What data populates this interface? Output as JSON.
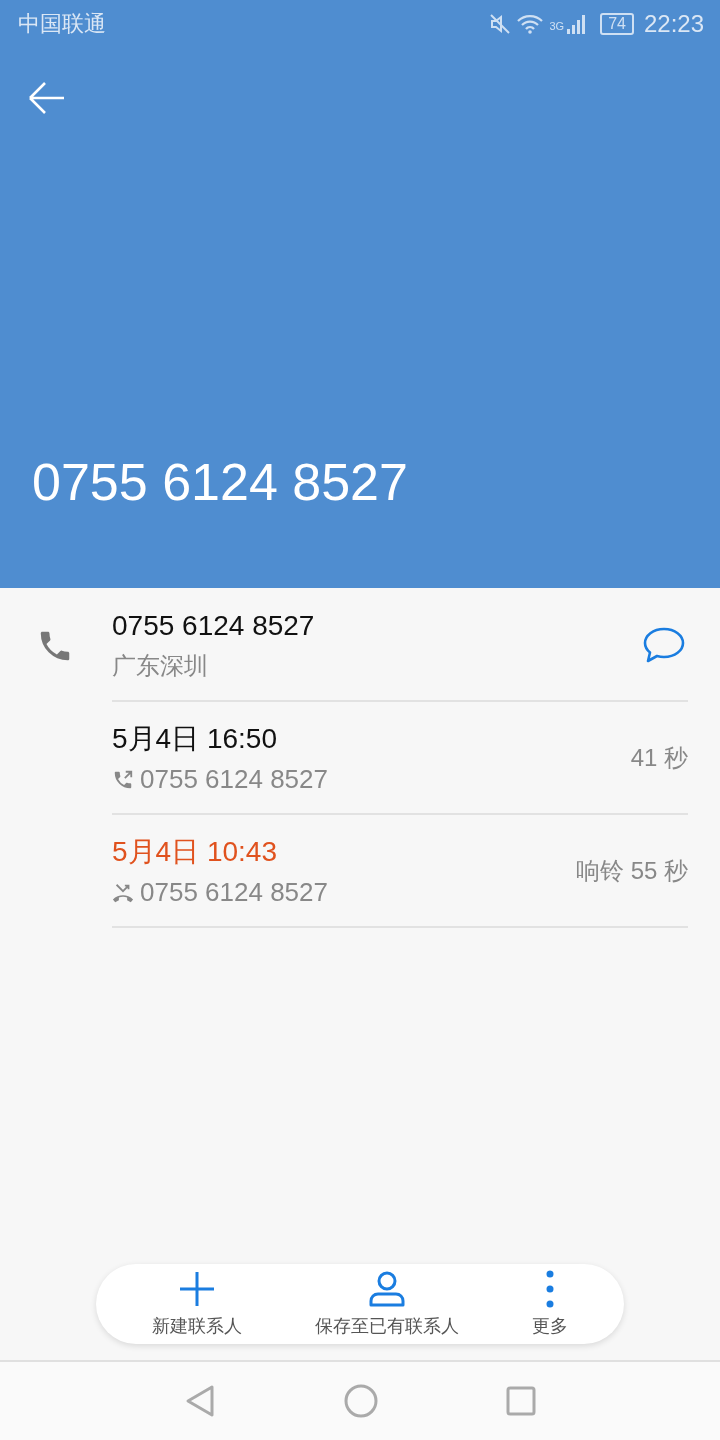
{
  "status_bar": {
    "carrier": "中国联通",
    "network": "3G",
    "battery": "74",
    "time": "22:23"
  },
  "header": {
    "title": "0755 6124 8527"
  },
  "contact": {
    "number": "0755 6124 8527",
    "location": "广东深圳"
  },
  "calls": [
    {
      "kind": "outgoing",
      "datetime": "5月4日 16:50",
      "number": "0755 6124 8527",
      "duration": "41 秒"
    },
    {
      "kind": "missed",
      "datetime": "5月4日 10:43",
      "number": "0755 6124 8527",
      "duration": "响铃 55 秒"
    }
  ],
  "actions": [
    {
      "kind": "add",
      "label": "新建联系人"
    },
    {
      "kind": "person",
      "label": "保存至已有联系人"
    },
    {
      "kind": "more",
      "label": "更多"
    }
  ]
}
